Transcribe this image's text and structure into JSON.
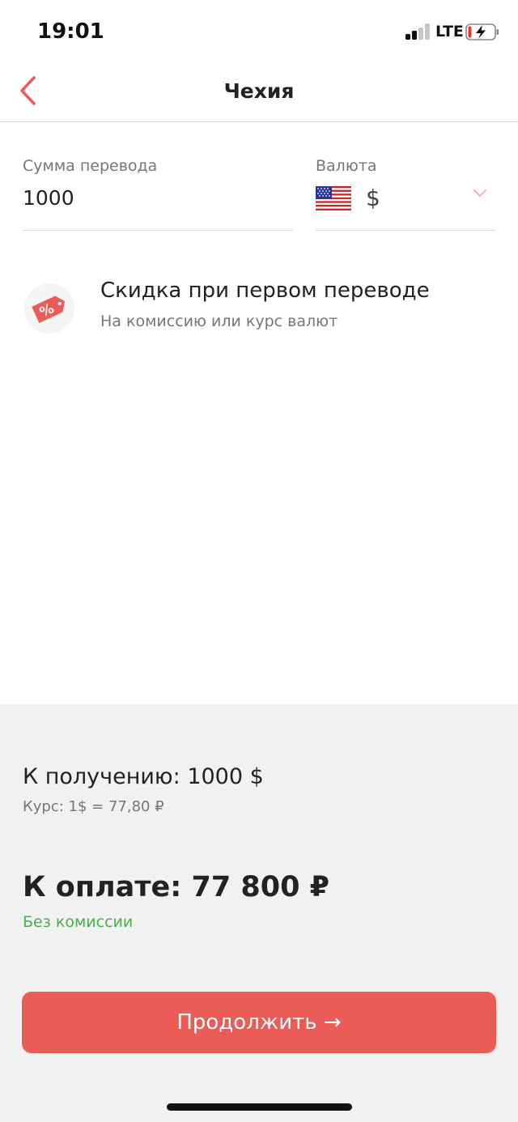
{
  "status_bar": {
    "time": "19:01",
    "network": "LTE",
    "icons": [
      "signal-icon",
      "battery-charging-icon"
    ]
  },
  "nav": {
    "title": "Чехия",
    "back_icon": "chevron-left-icon"
  },
  "form": {
    "amount": {
      "label": "Сумма перевода",
      "value": "1000"
    },
    "currency": {
      "label": "Валюта",
      "symbol": "$",
      "flag_icon": "us-flag-icon",
      "dropdown_icon": "chevron-down-icon"
    }
  },
  "promo": {
    "icon": "discount-tag-icon",
    "title": "Скидка при первом переводе",
    "subtitle": "На комиссию или курс валют"
  },
  "summary": {
    "receive": "К получению: 1000 $",
    "rate": "Курс: 1$ = 77,80 ₽",
    "payment": "К оплате: 77 800 ₽",
    "fee_note": "Без комиссии"
  },
  "actions": {
    "continue_label": "Продолжить →"
  },
  "colors": {
    "accent": "#ec5c57",
    "success": "#4caf50",
    "summary_bg": "#f1f1f1"
  }
}
